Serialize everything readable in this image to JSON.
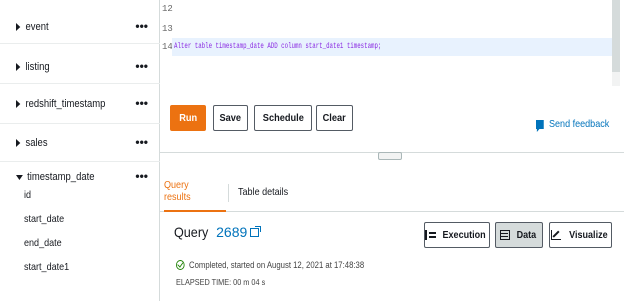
{
  "sidebar": {
    "tables": [
      {
        "label": "event",
        "expanded": false
      },
      {
        "label": "listing",
        "expanded": false
      },
      {
        "label": "redshift_timestamp",
        "expanded": false
      },
      {
        "label": "sales",
        "expanded": false
      },
      {
        "label": "timestamp_date",
        "expanded": true
      }
    ],
    "more_glyph": "•••",
    "columns": [
      "id",
      "start_date",
      "end_date",
      "start_date1"
    ]
  },
  "editor": {
    "lines": [
      {
        "number": "12",
        "text": ""
      },
      {
        "number": "13",
        "text": ""
      },
      {
        "number": "14",
        "text": "Alter table timestamp_date ADD column start_date1 timestamp;"
      }
    ]
  },
  "toolbar": {
    "run_label": "Run",
    "save_label": "Save",
    "schedule_label": "Schedule",
    "clear_label": "Clear",
    "feedback_label": "Send feedback"
  },
  "results": {
    "tabs": [
      {
        "label": "Query results",
        "active": true
      },
      {
        "label": "Table details",
        "active": false
      }
    ],
    "query_label": "Query",
    "query_id": "2689",
    "status_text": "Completed, started on August 12, 2021 at 17:48:38",
    "elapsed_text": "ELAPSED TIME: 00 m 04 s",
    "buttons": {
      "execution": "Execution",
      "data": "Data",
      "visualize": "Visualize"
    }
  },
  "colors": {
    "accent": "#ec7211",
    "link": "#0073bb",
    "success": "#1d8102",
    "current_line": "#e8f2fe"
  }
}
